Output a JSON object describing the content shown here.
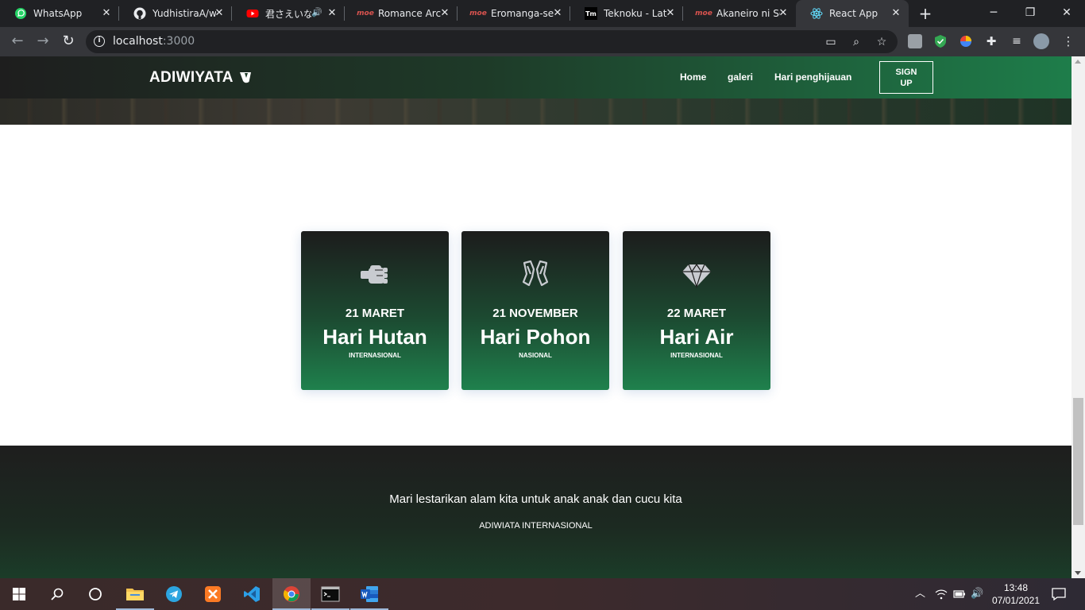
{
  "browser": {
    "tabs": [
      {
        "title": "WhatsApp",
        "icon": "whatsapp-icon"
      },
      {
        "title": "YudhistiraA/w",
        "icon": "github-icon"
      },
      {
        "title": "君さえいなけ",
        "icon": "youtube-icon"
      },
      {
        "title": "Romance Arch",
        "icon": "moe-icon"
      },
      {
        "title": "Eromanga-sen",
        "icon": "moe-icon"
      },
      {
        "title": "Teknoku - Late",
        "icon": "tm-icon"
      },
      {
        "title": "Akaneiro ni So",
        "icon": "moe-icon"
      },
      {
        "title": "React App",
        "icon": "react-icon"
      }
    ],
    "active_tab_index": 7,
    "url_host": "localhost",
    "url_port": ":3000"
  },
  "page": {
    "nav": {
      "brand": "ADIWIYATA",
      "links": [
        "Home",
        "galeri",
        "Hari penghijauan"
      ],
      "signup_line1": "SIGN",
      "signup_line2": "UP"
    },
    "cards": [
      {
        "date": "21 MARET",
        "title": "Hari Hutan",
        "subtitle": "INTERNASIONAL",
        "icon": "fist-icon"
      },
      {
        "date": "21 NOVEMBER",
        "title": "Hari Pohon",
        "subtitle": "NASIONAL",
        "icon": "hands-icon"
      },
      {
        "date": "22 MARET",
        "title": "Hari Air",
        "subtitle": "INTERNASIONAL",
        "icon": "diamond-icon"
      }
    ],
    "footer": {
      "message": "Mari lestarikan alam kita untuk anak anak dan cucu kita",
      "org": "ADIWIATA INTERNASIONAL"
    }
  },
  "taskbar": {
    "time": "13:48",
    "date": "07/01/2021"
  },
  "colors": {
    "nav_gradient_end": "#1e7d4a",
    "card_gradient_end": "#1f814d",
    "dark": "#1e1e1e"
  }
}
